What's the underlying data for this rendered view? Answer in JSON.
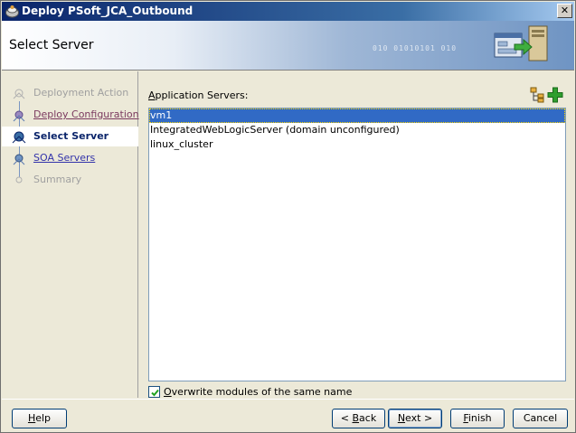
{
  "window": {
    "title": "Deploy PSoft_JCA_Outbound",
    "close_glyph": "✕"
  },
  "header": {
    "title": "Select Server",
    "binary_decoration": "010   01010101 010"
  },
  "nav": {
    "items": [
      {
        "label": "Deployment Action",
        "state": "disabled"
      },
      {
        "label": "Deploy Configuration",
        "state": "visited"
      },
      {
        "label": "Select Server",
        "state": "current"
      },
      {
        "label": "SOA Servers",
        "state": "link"
      },
      {
        "label": "Summary",
        "state": "disabled"
      }
    ]
  },
  "servers": {
    "label_mnemonic": "A",
    "label_rest": "pplication Servers:",
    "items": [
      {
        "name": "vm1",
        "selected": true
      },
      {
        "name": "IntegratedWebLogicServer (domain unconfigured)",
        "selected": false
      },
      {
        "name": "linux_cluster",
        "selected": false
      }
    ],
    "refresh_icon": "server-tree-icon",
    "add_icon": "add-icon"
  },
  "overwrite": {
    "checked": true,
    "label_mnemonic": "O",
    "label_rest": "verwrite modules of the same name"
  },
  "buttons": {
    "help_m": "H",
    "help_r": "elp",
    "back_pre": "< ",
    "back_m": "B",
    "back_r": "ack",
    "next_m": "N",
    "next_r": "ext >",
    "finish_m": "F",
    "finish_r": "inish",
    "cancel": "Cancel"
  },
  "colors": {
    "selection": "#316ac5",
    "title_bar": "#0a246a",
    "add_green": "#2e9e2e"
  }
}
